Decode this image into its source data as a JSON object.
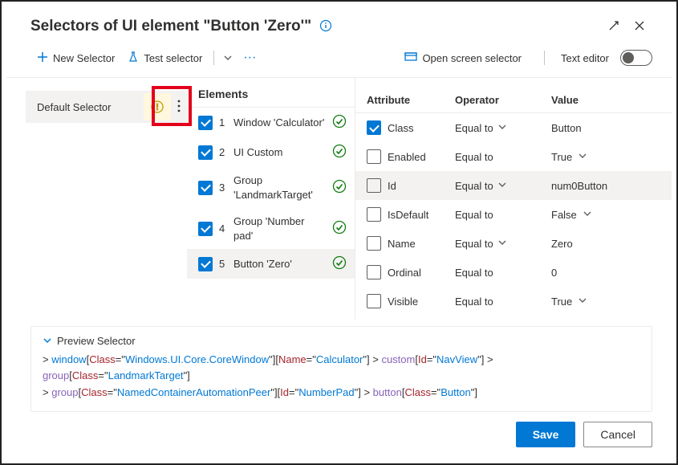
{
  "header": {
    "title": "Selectors of UI element \"Button 'Zero'\""
  },
  "toolbar": {
    "new_selector": "New Selector",
    "test_selector": "Test selector",
    "open_screen": "Open screen selector",
    "text_editor": "Text editor"
  },
  "left": {
    "default_selector": "Default Selector"
  },
  "elements": {
    "heading": "Elements",
    "rows": [
      {
        "n": "1",
        "label": "Window 'Calculator'",
        "checked": true
      },
      {
        "n": "2",
        "label": "UI Custom",
        "checked": true
      },
      {
        "n": "3",
        "label": "Group 'LandmarkTarget'",
        "checked": true
      },
      {
        "n": "4",
        "label": "Group 'Number pad'",
        "checked": true
      },
      {
        "n": "5",
        "label": "Button 'Zero'",
        "checked": true,
        "selected": true
      }
    ]
  },
  "attrs": {
    "head": {
      "attr": "Attribute",
      "op": "Operator",
      "val": "Value"
    },
    "rows": [
      {
        "checked": true,
        "attr": "Class",
        "op": "Equal to",
        "op_chev": true,
        "val": "Button",
        "val_chev": false
      },
      {
        "checked": false,
        "attr": "Enabled",
        "op": "Equal to",
        "op_chev": false,
        "val": "True",
        "val_chev": true
      },
      {
        "checked": false,
        "attr": "Id",
        "op": "Equal to",
        "op_chev": true,
        "val": "num0Button",
        "val_chev": false,
        "hl": true
      },
      {
        "checked": false,
        "attr": "IsDefault",
        "op": "Equal to",
        "op_chev": false,
        "val": "False",
        "val_chev": true
      },
      {
        "checked": false,
        "attr": "Name",
        "op": "Equal to",
        "op_chev": true,
        "val": "Zero",
        "val_chev": false
      },
      {
        "checked": false,
        "attr": "Ordinal",
        "op": "Equal to",
        "op_chev": false,
        "val": "0",
        "val_chev": false
      },
      {
        "checked": false,
        "attr": "Visible",
        "op": "Equal to",
        "op_chev": false,
        "val": "True",
        "val_chev": true
      }
    ]
  },
  "preview": {
    "heading": "Preview Selector",
    "tokens": [
      {
        "t": "> ",
        "c": "t-op"
      },
      {
        "t": "window",
        "c": "t-win"
      },
      {
        "t": "[",
        "c": "t-op"
      },
      {
        "t": "Class",
        "c": "t-key"
      },
      {
        "t": "=\"",
        "c": "t-op"
      },
      {
        "t": "Windows.UI.Core.CoreWindow",
        "c": "t-val"
      },
      {
        "t": "\"][",
        "c": "t-op"
      },
      {
        "t": "Name",
        "c": "t-key"
      },
      {
        "t": "=\"",
        "c": "t-op"
      },
      {
        "t": "Calculator",
        "c": "t-val"
      },
      {
        "t": "\"] ",
        "c": "t-op"
      },
      {
        "t": "> ",
        "c": "t-op"
      },
      {
        "t": "custom",
        "c": "t-cus"
      },
      {
        "t": "[",
        "c": "t-op"
      },
      {
        "t": "Id",
        "c": "t-key"
      },
      {
        "t": "=\"",
        "c": "t-op"
      },
      {
        "t": "NavView",
        "c": "t-val"
      },
      {
        "t": "\"] ",
        "c": "t-op"
      },
      {
        "t": "> ",
        "c": "t-op"
      },
      {
        "t": "group",
        "c": "t-grp"
      },
      {
        "t": "[",
        "c": "t-op"
      },
      {
        "t": "Class",
        "c": "t-key"
      },
      {
        "t": "=\"",
        "c": "t-op"
      },
      {
        "t": "LandmarkTarget",
        "c": "t-val"
      },
      {
        "t": "\"]",
        "c": "t-op"
      },
      {
        "t": "\n",
        "c": ""
      },
      {
        "t": "> ",
        "c": "t-op"
      },
      {
        "t": "group",
        "c": "t-grp"
      },
      {
        "t": "[",
        "c": "t-op"
      },
      {
        "t": "Class",
        "c": "t-key"
      },
      {
        "t": "=\"",
        "c": "t-op"
      },
      {
        "t": "NamedContainerAutomationPeer",
        "c": "t-val"
      },
      {
        "t": "\"][",
        "c": "t-op"
      },
      {
        "t": "Id",
        "c": "t-key"
      },
      {
        "t": "=\"",
        "c": "t-op"
      },
      {
        "t": "NumberPad",
        "c": "t-val"
      },
      {
        "t": "\"] ",
        "c": "t-op"
      },
      {
        "t": "> ",
        "c": "t-op"
      },
      {
        "t": "button",
        "c": "t-btn"
      },
      {
        "t": "[",
        "c": "t-op"
      },
      {
        "t": "Class",
        "c": "t-key"
      },
      {
        "t": "=\"",
        "c": "t-op"
      },
      {
        "t": "Button",
        "c": "t-val"
      },
      {
        "t": "\"]",
        "c": "t-op"
      }
    ]
  },
  "footer": {
    "save": "Save",
    "cancel": "Cancel"
  }
}
